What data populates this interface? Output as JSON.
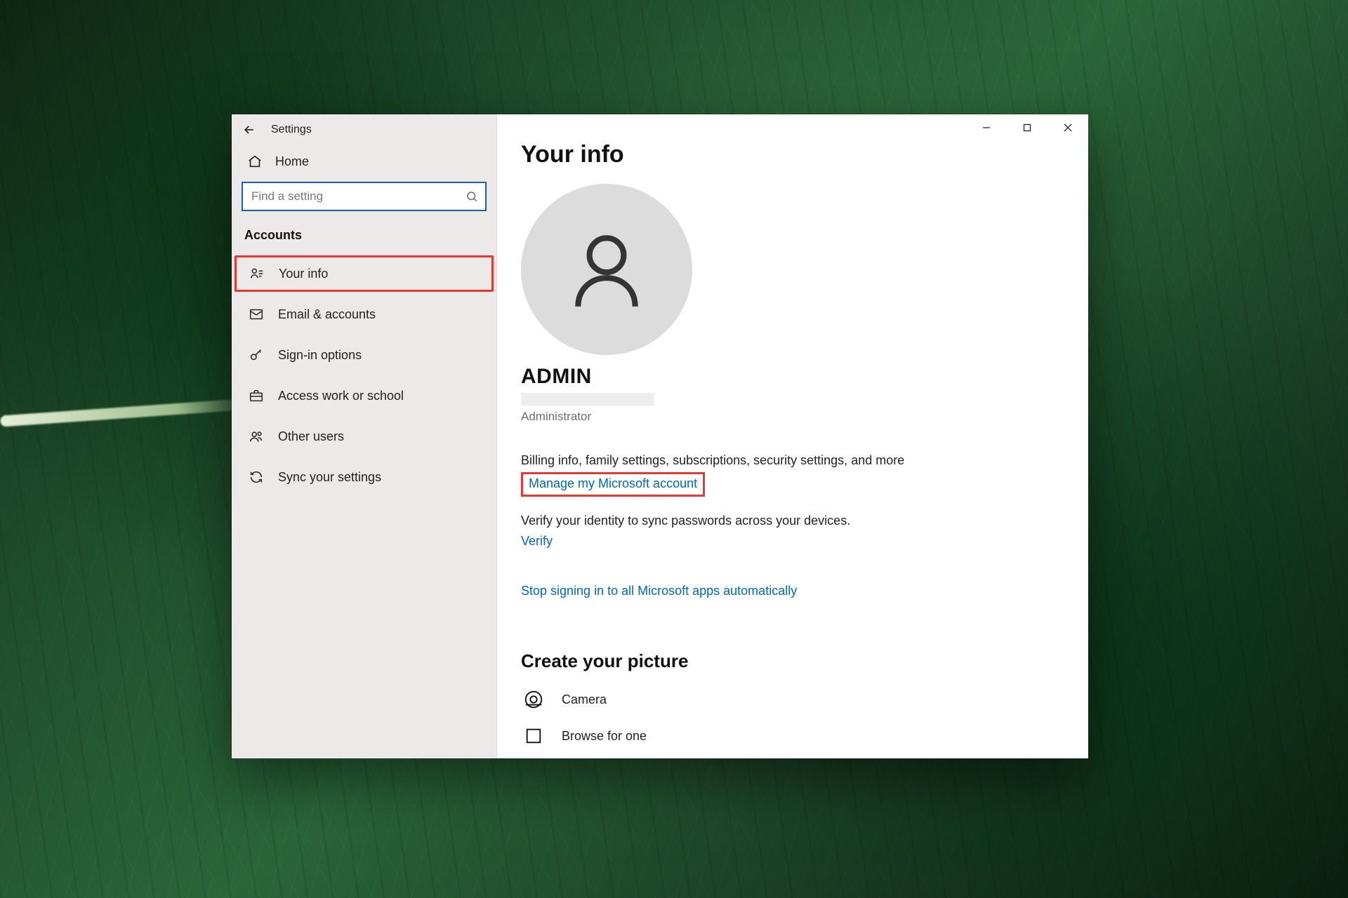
{
  "window": {
    "title": "Settings"
  },
  "sidebar": {
    "home": "Home",
    "search_placeholder": "Find a setting",
    "section": "Accounts",
    "items": [
      {
        "label": "Your info"
      },
      {
        "label": "Email & accounts"
      },
      {
        "label": "Sign-in options"
      },
      {
        "label": "Access work or school"
      },
      {
        "label": "Other users"
      },
      {
        "label": "Sync your settings"
      }
    ]
  },
  "main": {
    "title": "Your info",
    "user_name": "ADMIN",
    "role": "Administrator",
    "billing_line": "Billing info, family settings, subscriptions, security settings, and more",
    "manage_link": "Manage my Microsoft account",
    "verify_line": "Verify your identity to sync passwords across your devices.",
    "verify_link": "Verify",
    "stop_link": "Stop signing in to all Microsoft apps automatically",
    "picture_heading": "Create your picture",
    "camera_label": "Camera",
    "browse_label": "Browse for one"
  }
}
